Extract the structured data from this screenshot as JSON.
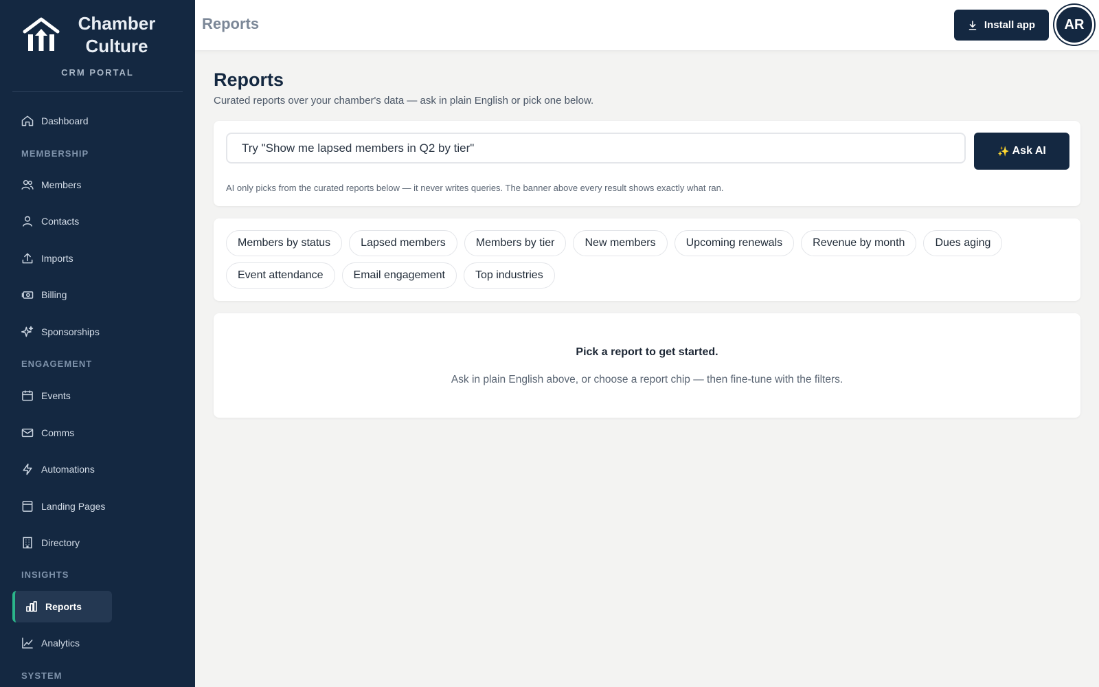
{
  "brand": {
    "name_line1": "Chamber",
    "name_line2": "Culture",
    "subtitle": "CRM PORTAL"
  },
  "sidebar": {
    "items": [
      {
        "label": "Dashboard",
        "icon": "home-icon"
      },
      {
        "section": "MEMBERSHIP"
      },
      {
        "label": "Members",
        "icon": "users-icon"
      },
      {
        "label": "Contacts",
        "icon": "user-icon"
      },
      {
        "label": "Imports",
        "icon": "upload-icon"
      },
      {
        "label": "Billing",
        "icon": "money-icon"
      },
      {
        "label": "Sponsorships",
        "icon": "sparkles-icon"
      },
      {
        "section": "ENGAGEMENT"
      },
      {
        "label": "Events",
        "icon": "calendar-icon"
      },
      {
        "label": "Comms",
        "icon": "mail-icon"
      },
      {
        "label": "Automations",
        "icon": "bolt-icon"
      },
      {
        "label": "Landing Pages",
        "icon": "layout-icon"
      },
      {
        "label": "Directory",
        "icon": "building-icon"
      },
      {
        "section": "INSIGHTS"
      },
      {
        "label": "Reports",
        "icon": "bar-chart-icon",
        "active": true
      },
      {
        "label": "Analytics",
        "icon": "line-chart-icon"
      },
      {
        "section": "SYSTEM"
      }
    ]
  },
  "header": {
    "title": "Reports",
    "install_label": "Install app",
    "avatar_initials": "AR"
  },
  "main": {
    "title": "Reports",
    "subtitle": "Curated reports over your chamber's data — ask in plain English or pick one below.",
    "ask": {
      "placeholder": "Try \"Show me lapsed members in Q2 by tier\"",
      "button_label": "Ask AI",
      "note": "AI only picks from the curated reports below — it never writes queries. The banner above every result shows exactly what ran."
    },
    "chips": [
      "Members by status",
      "Lapsed members",
      "Members by tier",
      "New members",
      "Upcoming renewals",
      "Revenue by month",
      "Dues aging",
      "Event attendance",
      "Email engagement",
      "Top industries"
    ],
    "empty_state": {
      "title": "Pick a report to get started.",
      "text": "Ask in plain English above, or choose a report chip — then fine-tune with the filters."
    }
  },
  "colors": {
    "sidebar_bg": "#142841",
    "accent": "#2bb58a",
    "page_bg": "#f3f3f2"
  }
}
